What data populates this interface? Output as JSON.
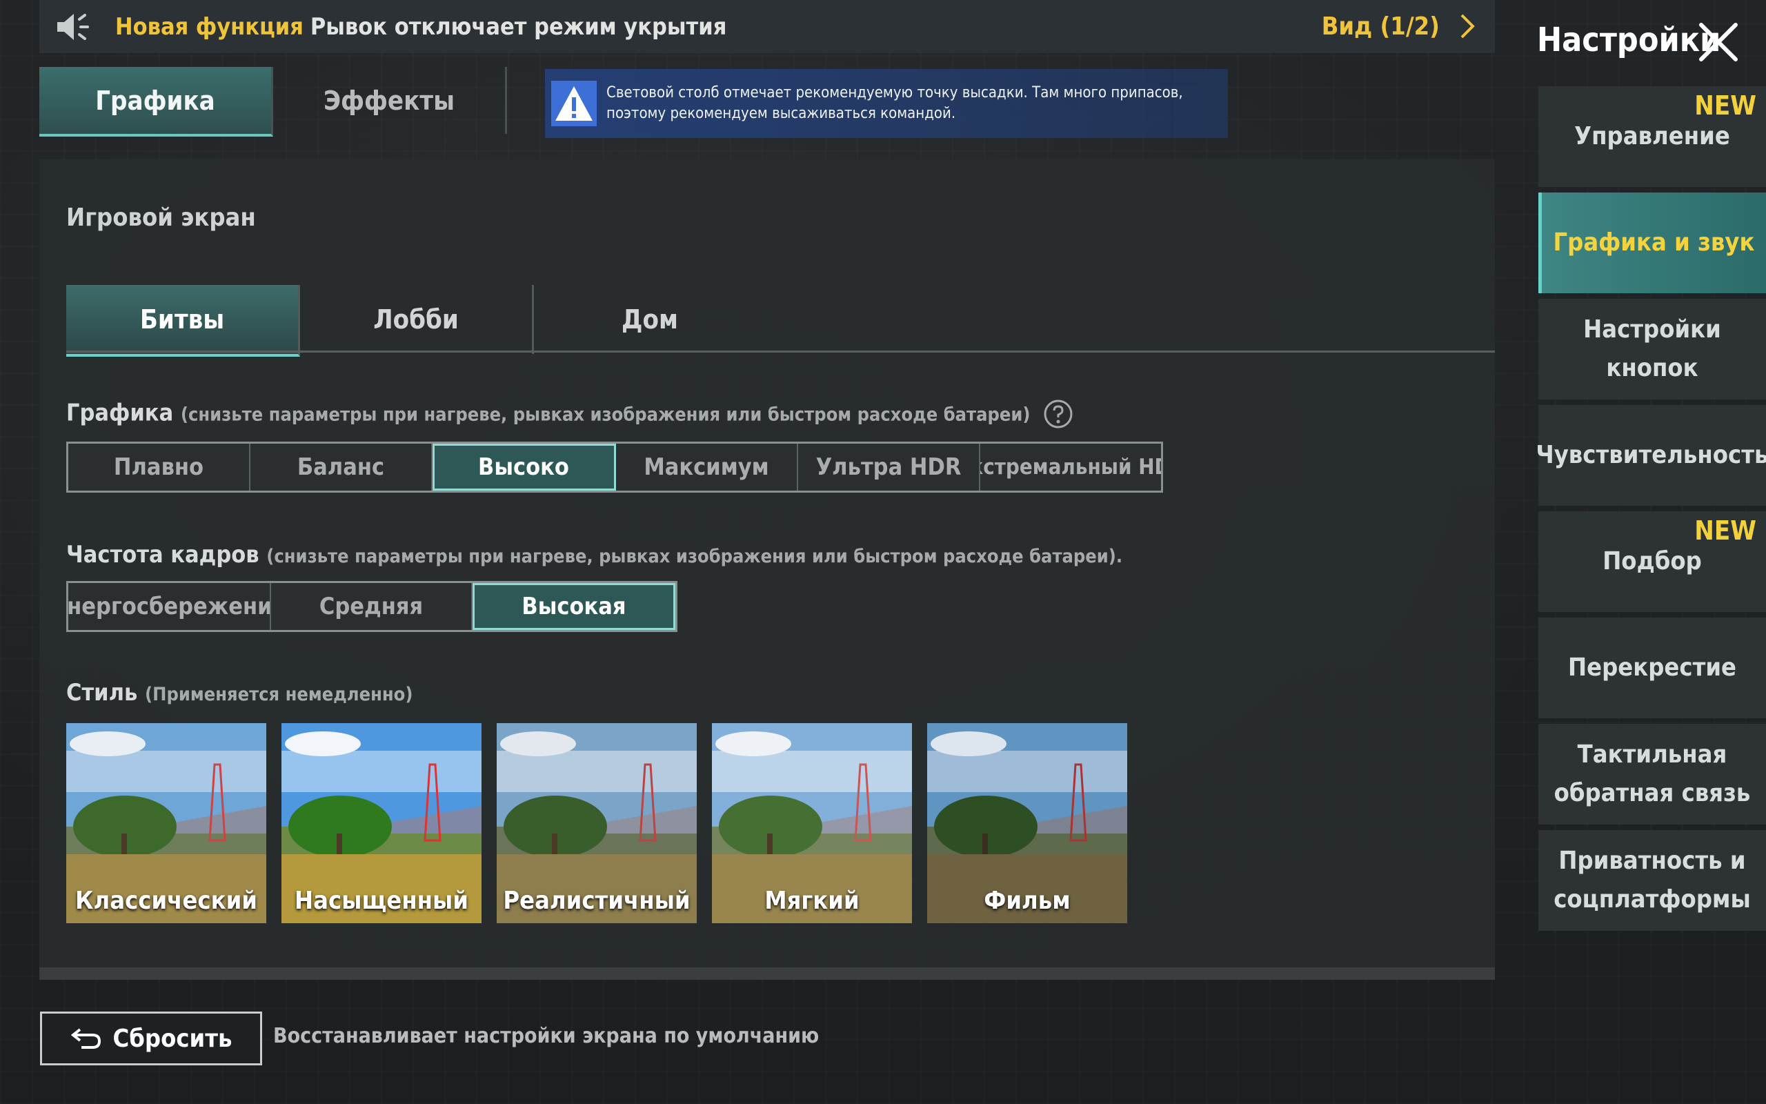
{
  "topbar": {
    "notice_tag": "Новая функция",
    "notice_text": "Рывок отключает режим укрытия",
    "view_label": "Вид (1/2)"
  },
  "sidebar": {
    "title": "Настройки",
    "items": [
      {
        "label": "Управление",
        "badge": "NEW",
        "active": false
      },
      {
        "label": "Графика и звук",
        "badge": "",
        "active": true
      },
      {
        "label": "Настройки кнопок",
        "badge": "",
        "active": false
      },
      {
        "label": "Чувствительность",
        "badge": "",
        "active": false
      },
      {
        "label": "Подбор",
        "badge": "NEW",
        "active": false
      },
      {
        "label": "Перекрестие",
        "badge": "",
        "active": false
      },
      {
        "label": "Тактильная обратная связь",
        "badge": "",
        "active": false
      },
      {
        "label": "Приватность и соцплатформы",
        "badge": "",
        "active": false
      }
    ]
  },
  "main_tabs": [
    "Графика",
    "Эффекты"
  ],
  "hint": {
    "text": "Световой столб отмечает рекомендуемую точку высадки. Там много припасов, поэтому рекомендуем высаживаться командой."
  },
  "game_screen": {
    "title": "Игровой экран",
    "tabs": [
      "Битвы",
      "Лобби",
      "Дом"
    ],
    "active_tab": "Битвы"
  },
  "graphics": {
    "title": "Графика",
    "note": "(снизьте параметры при нагреве, рывках изображения или быстром расходе батареи)",
    "options": [
      "Плавно",
      "Баланс",
      "Высоко",
      "Максимум",
      "Ультра HDR",
      "Экстремальный HDR"
    ],
    "selected": "Высоко"
  },
  "frame_rate": {
    "title": "Частота кадров",
    "note": "(снизьте параметры при нагреве, рывках изображения или быстром расходе батареи).",
    "options": [
      "Энергосбережение",
      "Средняя",
      "Высокая"
    ],
    "selected": "Высокая"
  },
  "style": {
    "title": "Стиль",
    "note": "(Применяется немедленно)",
    "options": [
      "Классический",
      "Насыщенный",
      "Реалистичный",
      "Мягкий",
      "Фильм"
    ],
    "selected": "Классический"
  },
  "footer": {
    "reset_label": "Сбросить",
    "reset_desc": "Восстанавливает настройки экрана по умолчанию"
  },
  "colors": {
    "accent_yellow": "#f2d13d",
    "accent_teal": "#6ad1c9",
    "hint_blue": "#254078"
  }
}
